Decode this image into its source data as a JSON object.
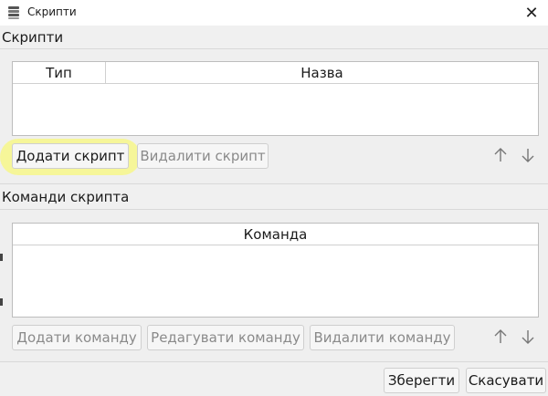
{
  "window": {
    "title": "Скрипти",
    "close_glyph": "✕"
  },
  "scripts_section": {
    "label": "Скрипти",
    "columns": [
      "Тип",
      "Назва"
    ],
    "rows": [],
    "add_button": "Додати скрипт",
    "delete_button": "Видалити скрипт"
  },
  "commands_section": {
    "label": "Команди скрипта",
    "columns": [
      "Команда"
    ],
    "rows": [],
    "add_button": "Додати команду",
    "edit_button": "Редагувати команду",
    "delete_button": "Видалити команду"
  },
  "footer": {
    "save_button": "Зберегти",
    "cancel_button": "Скасувати"
  },
  "colors": {
    "highlight": "#f7f78a",
    "disabled_text": "#8a8a8a"
  }
}
